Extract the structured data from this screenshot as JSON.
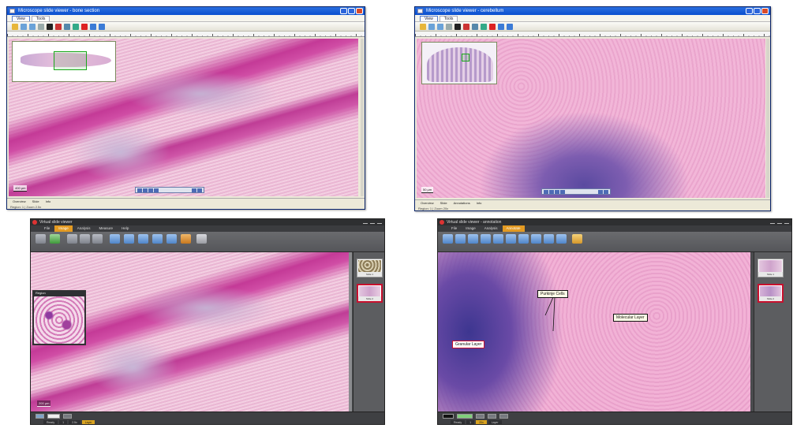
{
  "windows": [
    {
      "id": "top-left",
      "title": "Microscope slide viewer - bone section",
      "tabs": [
        "View",
        "Tools"
      ],
      "scale_label": "400 µm",
      "status_items": [
        "Overview",
        "Slide",
        "Info"
      ],
      "status_line": "Region: 1  |  Zoom 2.5x"
    },
    {
      "id": "top-right",
      "title": "Microscope slide viewer - cerebellum",
      "tabs": [
        "View",
        "Tools"
      ],
      "scale_label": "50 µm",
      "status_items": [
        "Overview",
        "Slide",
        "Annotations",
        "Info"
      ],
      "status_line": "Region: 1  |  Zoom 20x"
    },
    {
      "id": "bottom-left",
      "title": "Virtual slide viewer",
      "menu": [
        "File",
        "Image",
        "Analysis",
        "Measure",
        "Help"
      ],
      "menu_active": 1,
      "scale_label": "200 µm",
      "inset_title": "Region",
      "thumbnails": [
        "Slide 1",
        "Slide 2"
      ],
      "status_items": [
        "Ready",
        "1",
        "2.5x",
        "Layer"
      ]
    },
    {
      "id": "bottom-right",
      "title": "Virtual slide viewer - annotation",
      "menu": [
        "File",
        "Image",
        "Analysis",
        "Annotate"
      ],
      "menu_active": 3,
      "annotations": {
        "purkinje": "Purkinje Cells",
        "molecular": "Molecular Layer",
        "granular": "Granular Layer"
      },
      "thumbnails": [
        "Slide 1",
        "Slide 2"
      ],
      "status_items": [
        "Ready",
        "1",
        "20x",
        "Layer"
      ]
    }
  ],
  "colors": {
    "he_pink": "#efc3dc",
    "he_purple": "#5a4aa0",
    "roi_green": "#19a81a",
    "accent_orange": "#e39a22",
    "selected_red": "#c8102e"
  }
}
